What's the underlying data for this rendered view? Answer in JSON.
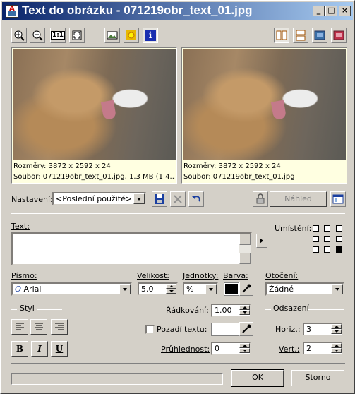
{
  "window": {
    "title": "Text do obrázku - 071219obr_text_01.jpg",
    "min_label": "_",
    "max_label": "□",
    "close_label": "×"
  },
  "toolbar": {
    "icons": [
      "zoom-in-icon",
      "zoom-out-icon",
      "actual-size-icon",
      "fit-icon",
      "landscape-icon",
      "sun-icon",
      "info-icon"
    ],
    "actual_size_label": "1:1",
    "info_label": "i",
    "view_icons": [
      "side-by-side-icon",
      "top-bottom-icon",
      "single-before-icon",
      "single-after-icon"
    ]
  },
  "preview_left": {
    "dimensions": "Rozměry: 3872 x 2592 x 24",
    "file": "Soubor: 071219obr_text_01.jpg, 1.3 MB (1 4..."
  },
  "preview_right": {
    "dimensions": "Rozměry: 3872 x 2592 x 24",
    "file": "Soubor: 071219obr_text_01.jpg"
  },
  "settings": {
    "label": "Nastavení:",
    "selected": "<Poslední použité>",
    "preview_button": "Náhled"
  },
  "text_section": {
    "label": "Text:",
    "value": "",
    "placement_label": "Umístění:"
  },
  "font": {
    "label": "Písmo:",
    "value": "Arial",
    "font_glyph": "O",
    "size_label": "Velikost:",
    "size_value": "5.0",
    "units_label": "Jednotky:",
    "units_value": "%",
    "color_label": "Barva:",
    "color": "#000000",
    "rotation_label": "Otočení:",
    "rotation_value": "Žádné"
  },
  "style": {
    "label": "Styl",
    "bold": "B",
    "italic": "I",
    "underline": "U"
  },
  "spacing": {
    "line_spacing_label": "Řádkování:",
    "line_spacing_value": "1.00",
    "background_label": "Pozadí textu:",
    "opacity_label": "Průhlednost:",
    "opacity_value": "0"
  },
  "offset": {
    "label": "Odsazení",
    "horiz_label": "Horiz.:",
    "horiz_value": "3",
    "vert_label": "Vert.:",
    "vert_value": "2"
  },
  "buttons": {
    "ok": "OK",
    "cancel": "Storno"
  }
}
